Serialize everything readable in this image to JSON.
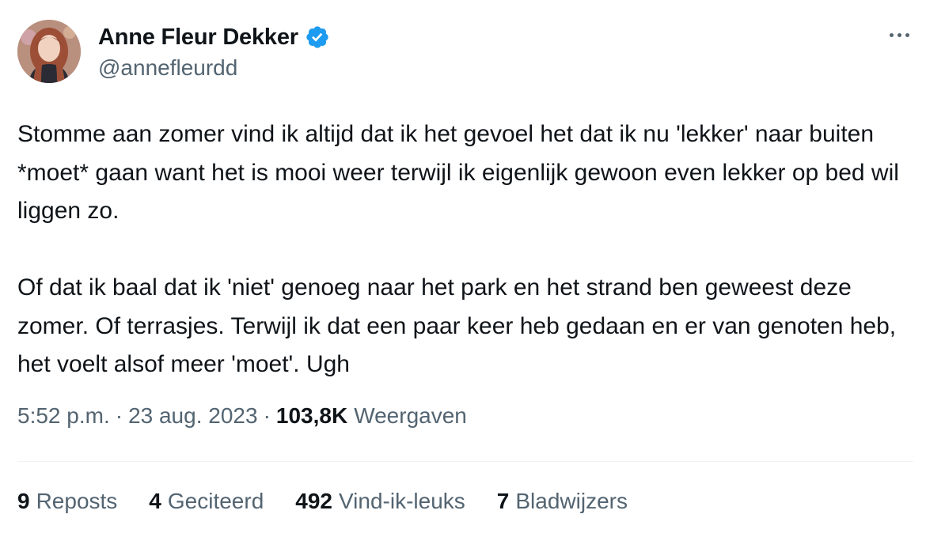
{
  "author": {
    "display_name": "Anne Fleur Dekker",
    "handle": "@annefleurdd",
    "verified": true,
    "avatar_icon": "profile-photo"
  },
  "tweet": {
    "paragraphs": [
      "Stomme aan zomer vind ik altijd dat ik het gevoel het dat ik nu 'lekker' naar buiten *moet* gaan want het is mooi weer terwijl ik eigenlijk gewoon even lekker op bed wil liggen zo.",
      "Of dat ik baal dat ik 'niet' genoeg naar het park en het strand ben geweest deze zomer. Of terrasjes. Terwijl ik dat een paar keer heb gedaan en er van genoten heb, het voelt alsof meer 'moet'. Ugh"
    ]
  },
  "meta": {
    "time": "5:52 p.m.",
    "separator": "·",
    "date": "23 aug. 2023",
    "views_count": "103,8K",
    "views_label": "Weergaven"
  },
  "stats": [
    {
      "num": "9",
      "label": "Reposts"
    },
    {
      "num": "4",
      "label": "Geciteerd"
    },
    {
      "num": "492",
      "label": "Vind-ik-leuks"
    },
    {
      "num": "7",
      "label": "Bladwijzers"
    }
  ],
  "colors": {
    "text": "#0f1419",
    "secondary": "#536471",
    "verified": "#1d9bf0",
    "divider": "#eff3f4"
  },
  "icons": {
    "more": "more-horizontal-icon",
    "verified": "verified-badge-icon"
  }
}
